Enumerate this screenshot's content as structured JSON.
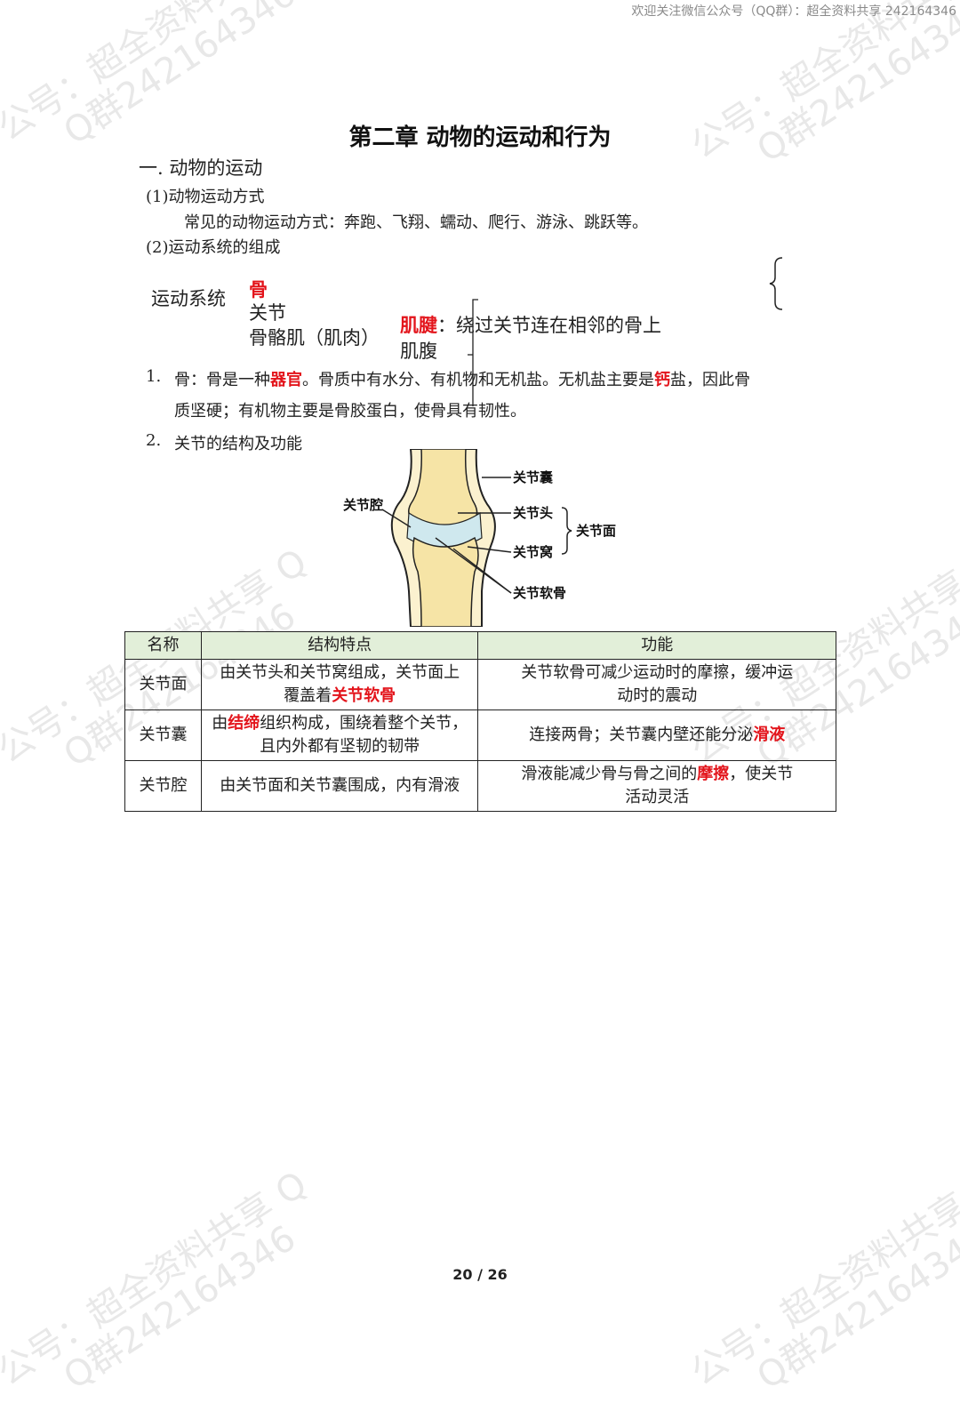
{
  "header": {
    "text": "欢迎关注微信公众号（QQ群）：超全资料共享 242164346"
  },
  "watermark": {
    "line1": "公号：超全资料共享 Q",
    "line2": "Q群242164346"
  },
  "title": "第二章 动物的运动和行为",
  "section1": {
    "heading": "一. 动物的运动",
    "sub1": "(1)动物运动方式",
    "sub1_text": "常见的动物运动方式：奔跑、飞翔、蠕动、爬行、游泳、跳跃等。",
    "sub2": "(2)运动系统的组成"
  },
  "motor_system": {
    "root": "运动系统",
    "bone": "骨",
    "joint": "关节",
    "muscle": "骨骼肌（肌肉）",
    "tendon_label": "肌腱",
    "tendon_desc": "：绕过关节连在相邻的骨上",
    "belly": "肌腹"
  },
  "item1": {
    "num": "1.",
    "p1": "骨：骨是一种",
    "h1": "器官",
    "p2": "。骨质中有水分、有机物和无机盐。无机盐主要是",
    "h2": "钙",
    "p3": "盐，因此骨",
    "line2": "质坚硬；有机物主要是骨胶蛋白，使骨具有韧性。"
  },
  "item2": {
    "num": "2.",
    "text": "关节的结构及功能"
  },
  "diagram": {
    "labels": {
      "capsule": "关节囊",
      "head": "关节头",
      "socket": "关节窝",
      "surface": "关节面",
      "cartilage": "关节软骨",
      "cavity": "关节腔"
    }
  },
  "table": {
    "headers": [
      "名称",
      "结构特点",
      "功能"
    ],
    "row1": {
      "name": "关节面",
      "s1": "由关节头和关节窝组成，关节面上",
      "s2": "覆盖着",
      "s2h": "关节软骨",
      "f": "关节软骨可减少运动时的摩擦，缓冲运动时的震动"
    },
    "row2": {
      "name": "关节囊",
      "s1": "由",
      "s1h": "结缔",
      "s2": "组织构成，围绕着整个关节，",
      "s3": "且内外都有坚韧的韧带",
      "f1": "连接两骨；关节囊内壁还能分泌",
      "fh": "滑液"
    },
    "row3": {
      "name": "关节腔",
      "s": "由关节面和关节囊围成，内有滑液",
      "f1": "滑液能减少骨与骨之间的",
      "fh": "摩擦",
      "f2": "，使关节活动灵活"
    }
  },
  "page_number": "20 / 26"
}
